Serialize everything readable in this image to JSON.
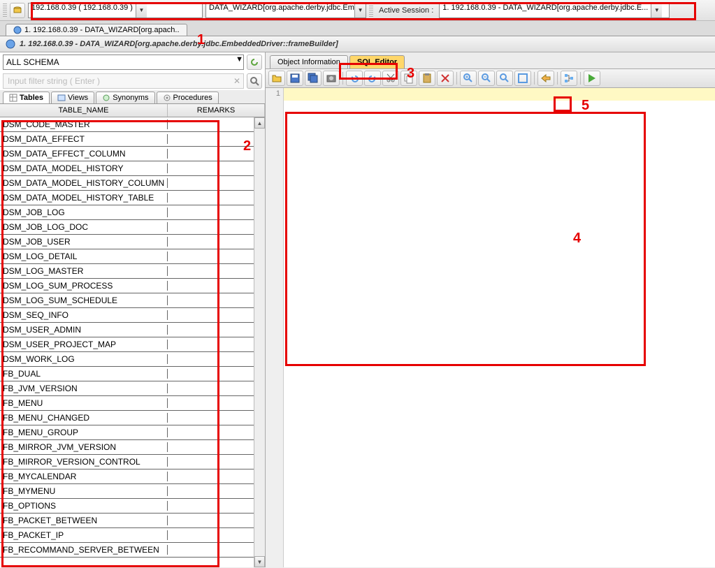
{
  "top": {
    "host_combo": "192.168.0.39 ( 192.168.0.39 )",
    "db_combo": "DATA_WIZARD[org.apache.derby.jdbc.Em",
    "session_label": "Active Session :",
    "session_combo": "1. 192.168.0.39 - DATA_WIZARD[org.apache.derby.jdbc.E..."
  },
  "doc_tab": "1. 192.168.0.39 - DATA_WIZARD[org.apach..",
  "window_title": "1. 192.168.0.39 - DATA_WIZARD[org.apache.derby.jdbc.EmbeddedDriver::frameBuilder]",
  "schema_combo": "ALL SCHEMA",
  "filter_placeholder": "Input filter string ( Enter )",
  "obj_tabs": [
    "Tables",
    "Views",
    "Synonyms",
    "Procedures"
  ],
  "table_headers": {
    "name": "TABLE_NAME",
    "remarks": "REMARKS"
  },
  "tables": [
    "DSM_CODE_MASTER",
    "DSM_DATA_EFFECT",
    "DSM_DATA_EFFECT_COLUMN",
    "DSM_DATA_MODEL_HISTORY",
    "DSM_DATA_MODEL_HISTORY_COLUMN",
    "DSM_DATA_MODEL_HISTORY_TABLE",
    "DSM_JOB_LOG",
    "DSM_JOB_LOG_DOC",
    "DSM_JOB_USER",
    "DSM_LOG_DETAIL",
    "DSM_LOG_MASTER",
    "DSM_LOG_SUM_PROCESS",
    "DSM_LOG_SUM_SCHEDULE",
    "DSM_SEQ_INFO",
    "DSM_USER_ADMIN",
    "DSM_USER_PROJECT_MAP",
    "DSM_WORK_LOG",
    "FB_DUAL",
    "FB_JVM_VERSION",
    "FB_MENU",
    "FB_MENU_CHANGED",
    "FB_MENU_GROUP",
    "FB_MIRROR_JVM_VERSION",
    "FB_MIRROR_VERSION_CONTROL",
    "FB_MYCALENDAR",
    "FB_MYMENU",
    "FB_OPTIONS",
    "FB_PACKET_BETWEEN",
    "FB_PACKET_IP",
    "FB_RECOMMAND_SERVER_BETWEEN"
  ],
  "right_tabs": {
    "info": "Object Information",
    "sql": "SQL Editor"
  },
  "gutter_line": "1",
  "annotations": {
    "n1": "1",
    "n2": "2",
    "n3": "3",
    "n4": "4",
    "n5": "5"
  },
  "toolbar_icons": [
    "open-icon",
    "save-icon",
    "saveall-icon",
    "camera-icon",
    "undo-icon",
    "redo-icon",
    "cut-icon",
    "copy-icon",
    "paste-icon",
    "delete-icon",
    "zoomin-icon",
    "zoomout-icon",
    "zoomreset-icon",
    "zoomfit-icon",
    "nav-icon",
    "tree-icon",
    "run-icon"
  ]
}
